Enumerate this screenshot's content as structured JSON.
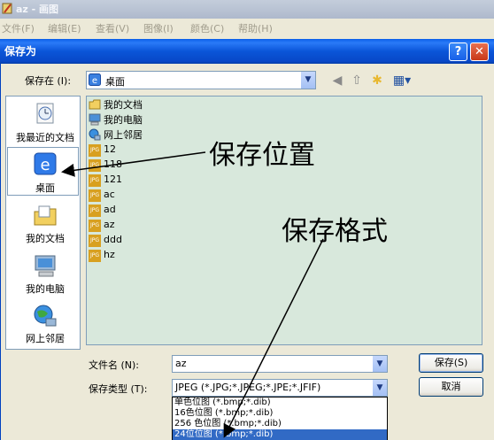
{
  "paint": {
    "title": "az - 画图",
    "menu": [
      "文件(F)",
      "编辑(E)",
      "查看(V)",
      "图像(I)",
      "颜色(C)",
      "帮助(H)"
    ]
  },
  "dialog": {
    "title": "保存为",
    "help_label": "?",
    "close_label": "✕",
    "save_in_label": "保存在 (I):",
    "save_in_value": "桌面",
    "places": [
      {
        "label": "我最近的文档",
        "icon": "recent-documents-icon"
      },
      {
        "label": "桌面",
        "icon": "desktop-icon"
      },
      {
        "label": "我的文档",
        "icon": "my-documents-icon"
      },
      {
        "label": "我的电脑",
        "icon": "my-computer-icon"
      },
      {
        "label": "网上邻居",
        "icon": "network-places-icon"
      }
    ],
    "files": [
      {
        "name": "我的文档",
        "icon": "folder-icon"
      },
      {
        "name": "我的电脑",
        "icon": "computer-icon"
      },
      {
        "name": "网上邻居",
        "icon": "network-icon"
      },
      {
        "name": "12",
        "icon": "jpg-file-icon"
      },
      {
        "name": "118",
        "icon": "jpg-file-icon"
      },
      {
        "name": "121",
        "icon": "jpg-file-icon"
      },
      {
        "name": "ac",
        "icon": "jpg-file-icon"
      },
      {
        "name": "ad",
        "icon": "jpg-file-icon"
      },
      {
        "name": "az",
        "icon": "jpg-file-icon"
      },
      {
        "name": "ddd",
        "icon": "jpg-file-icon"
      },
      {
        "name": "hz",
        "icon": "jpg-file-icon"
      }
    ],
    "jpg_badge": "JPG",
    "file_name_label": "文件名 (N):",
    "file_name_value": "az",
    "save_type_label": "保存类型 (T):",
    "save_type_value": "JPEG (*.JPG;*.JPEG;*.JPE;*.JFIF)",
    "save_button": "保存(S)",
    "cancel_button": "取消",
    "type_options": [
      {
        "label": "单色位图 (*.bmp;*.dib)",
        "selected": false
      },
      {
        "label": "16色位图 (*.bmp;*.dib)",
        "selected": false
      },
      {
        "label": "256 色位图 (*.bmp;*.dib)",
        "selected": false
      },
      {
        "label": "24位位图 (*.bmp;*.dib)",
        "selected": true
      }
    ]
  },
  "annotations": {
    "save_location": "保存位置",
    "save_format": "保存格式"
  },
  "colors": {
    "titlebar_blue": "#0a55d8",
    "file_list_bg": "#d8e8dc",
    "selection_blue": "#316ac5"
  }
}
